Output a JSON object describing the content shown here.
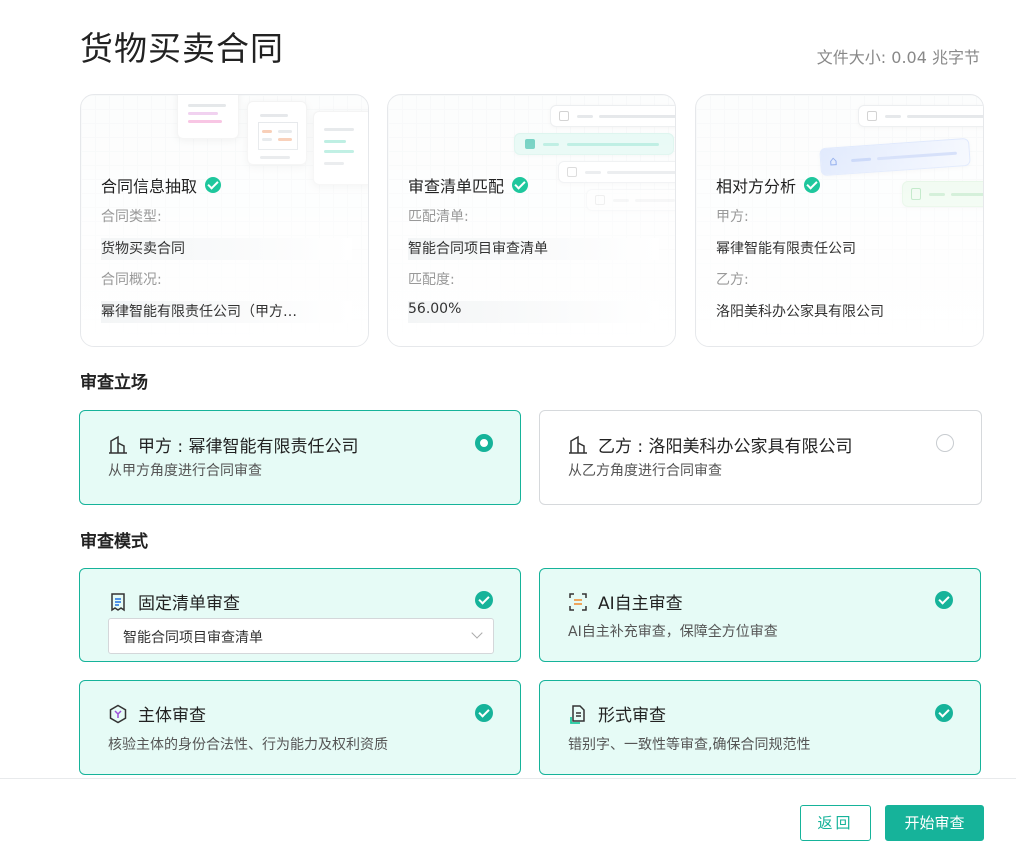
{
  "page": {
    "title": "货物买卖合同",
    "file_size": "文件大小: 0.04 兆字节"
  },
  "cards": [
    {
      "title": "合同信息抽取",
      "label1": "合同类型:",
      "value1": "货物买卖合同",
      "label2": "合同概况:",
      "value2": "幂律智能有限责任公司（甲方…"
    },
    {
      "title": "审查清单匹配",
      "label1": "匹配清单:",
      "value1": "智能合同项目审查清单",
      "label2": "匹配度:",
      "value2": "56.00%"
    },
    {
      "title": "相对方分析",
      "label1": "甲方:",
      "value1": "幂律智能有限责任公司",
      "label2": "乙方:",
      "value2": "洛阳美科办公家具有限公司"
    }
  ],
  "stance": {
    "heading": "审查立场",
    "options": [
      {
        "title": "甲方 : 幂律智能有限责任公司",
        "desc": "从甲方角度进行合同审查",
        "selected": true,
        "icon": "building-icon"
      },
      {
        "title": "乙方 : 洛阳美科办公家具有限公司",
        "desc": "从乙方角度进行合同审查",
        "selected": false,
        "icon": "building-icon"
      }
    ]
  },
  "mode": {
    "heading": "审查模式",
    "fixed": {
      "title": "固定清单审查",
      "select_value": "智能合同项目审查清单",
      "icon": "checklist-icon"
    },
    "ai": {
      "title": "AI自主审查",
      "desc": "AI自主补充审查，保障全方位审查",
      "icon": "ai-scan-icon"
    },
    "subject": {
      "title": "主体审查",
      "desc": "核验主体的身份合法性、行为能力及权利资质",
      "icon": "hexagon-icon"
    },
    "format": {
      "title": "形式审查",
      "desc": "错别字、一致性等审查,确保合同规范性",
      "icon": "document-icon"
    }
  },
  "footer": {
    "back_label": "返回",
    "start_label": "开始审查"
  },
  "colors": {
    "accent": "#16b39a",
    "check": "#1fc79d",
    "selected_bg": "#e6fbf6"
  }
}
